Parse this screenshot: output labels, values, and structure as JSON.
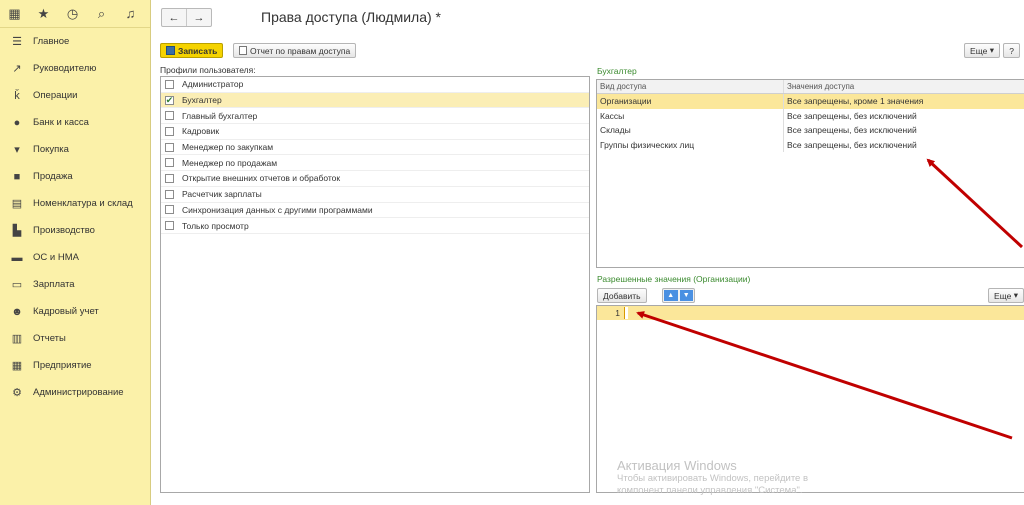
{
  "sidebar": {
    "top_icons": [
      "grid-icon",
      "star-icon",
      "history-icon",
      "search-icon",
      "bell-icon"
    ],
    "items": [
      {
        "label": "Главное",
        "icon": "menu-icon"
      },
      {
        "label": "Руководителю",
        "icon": "trend-icon"
      },
      {
        "label": "Операции",
        "icon": "operations-icon"
      },
      {
        "label": "Банк и касса",
        "icon": "bank-icon"
      },
      {
        "label": "Покупка",
        "icon": "cart-icon"
      },
      {
        "label": "Продажа",
        "icon": "bag-icon"
      },
      {
        "label": "Номенклатура и склад",
        "icon": "warehouse-icon"
      },
      {
        "label": "Производство",
        "icon": "factory-icon"
      },
      {
        "label": "ОС и НМА",
        "icon": "truck-icon"
      },
      {
        "label": "Зарплата",
        "icon": "money-icon"
      },
      {
        "label": "Кадровый учет",
        "icon": "people-icon"
      },
      {
        "label": "Отчеты",
        "icon": "reports-icon"
      },
      {
        "label": "Предприятие",
        "icon": "enterprise-icon"
      },
      {
        "label": "Администрирование",
        "icon": "gear-icon"
      }
    ]
  },
  "header": {
    "title": "Права доступа (Людмила) *"
  },
  "toolbar": {
    "save_label": "Записать",
    "report_label": "Отчет по правам доступа",
    "more_label": "Еще",
    "help_label": "?"
  },
  "profiles": {
    "label": "Профили пользователя:",
    "items": [
      {
        "label": "Администратор",
        "checked": false
      },
      {
        "label": "Бухгалтер",
        "checked": true
      },
      {
        "label": "Главный бухгалтер",
        "checked": false
      },
      {
        "label": "Кадровик",
        "checked": false
      },
      {
        "label": "Менеджер по закупкам",
        "checked": false
      },
      {
        "label": "Менеджер по продажам",
        "checked": false
      },
      {
        "label": "Открытие внешних отчетов и обработок",
        "checked": false
      },
      {
        "label": "Расчетчик зарплаты",
        "checked": false
      },
      {
        "label": "Синхронизация данных с другими программами",
        "checked": false
      },
      {
        "label": "Только просмотр",
        "checked": false
      }
    ]
  },
  "access": {
    "label": "Бухгалтер",
    "headers": [
      "Вид доступа",
      "Значения доступа"
    ],
    "rows": [
      [
        "Организации",
        "Все запрещены, кроме 1 значения"
      ],
      [
        "Кассы",
        "Все запрещены, без исключений"
      ],
      [
        "Склады",
        "Все запрещены, без исключений"
      ],
      [
        "Группы физических лиц",
        "Все запрещены, без исключений"
      ]
    ]
  },
  "allowed": {
    "label": "Разрешенные значения (Организации)",
    "add_label": "Добавить",
    "more_label": "Еще",
    "row_number": "1"
  },
  "watermark": {
    "title": "Активация Windows",
    "line1": "Чтобы активировать Windows, перейдите в",
    "line2": "компонент панели управления \"Система\"."
  },
  "colors": {
    "sidebar": "#fbf1a9",
    "accent": "#f5d300",
    "selection": "#fbe79a",
    "arrow": "#c00000",
    "group_label": "#3a8a2e"
  }
}
